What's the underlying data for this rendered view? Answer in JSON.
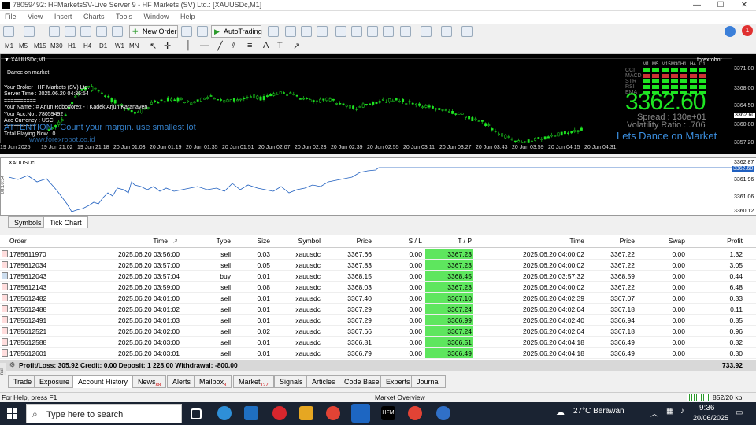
{
  "window": {
    "title": "78059492: HFMarketsSV-Live Server 9 - HF Markets (SV) Ltd.: [XAUUSDc,M1]"
  },
  "menu": [
    "File",
    "View",
    "Insert",
    "Charts",
    "Tools",
    "Window",
    "Help"
  ],
  "toolbar": {
    "new_order": "New Order",
    "autotrading": "AutoTrading"
  },
  "timeframes": [
    "M1",
    "M5",
    "M15",
    "M30",
    "H1",
    "H4",
    "D1",
    "W1",
    "MN"
  ],
  "chart": {
    "symbol": "XAUUSDc,M1",
    "brand": "forexrobot",
    "overlay_lines": [
      "Dance on market",
      "Your Broker : HF Markets (SV) Ltd.",
      "Server Time : 2025.06.20 04:36:54",
      "==========",
      "Your Name : # Arjun Robotforex - I Kadek Arjun Karanayen",
      "Your Acc.No : 78059492",
      "Acc Currency : USC",
      "==========",
      "Total Playing Now : 0"
    ],
    "warning": "ATTENTION - Count your margin. use smallest lot",
    "watermark": "www.forexrobot.co.id",
    "price_big": "3362.60",
    "spread": "Spread : 130e+01",
    "volatility": "Volatility Ratio : .706",
    "slogan": "Lets Dance on Market",
    "tf_panel": [
      "CCI",
      "MACD",
      "STR",
      "RSI",
      "EMA"
    ],
    "tf_headers": [
      "M1",
      "M5",
      "M15",
      "M30",
      "H1",
      "H4",
      "D1"
    ],
    "y_ticks": [
      "3371.80",
      "3368.00",
      "3364.50",
      "3362.60",
      "3360.80",
      "3357.20"
    ],
    "x_ticks": [
      "19 Jun 2025",
      "19 Jun 21:02",
      "19 Jun 21:18",
      "20 Jun 01:03",
      "20 Jun 01:19",
      "20 Jun 01:35",
      "20 Jun 01:51",
      "20 Jun 02:07",
      "20 Jun 02:23",
      "20 Jun 02:39",
      "20 Jun 02:55",
      "20 Jun 03:11",
      "20 Jun 03:27",
      "20 Jun 03:43",
      "20 Jun 03:59",
      "20 Jun 04:15",
      "20 Jun 04:31"
    ]
  },
  "tick": {
    "symbol": "XAUUSDc",
    "y_ticks": [
      "3362.87",
      "3362.60",
      "3361.96",
      "3361.06",
      "3360.12"
    ],
    "side_label": "08:10:54"
  },
  "panel_tabs": [
    "Symbols",
    "Tick Chart"
  ],
  "table": {
    "headers": [
      "Order",
      "Time",
      "Type",
      "Size",
      "Symbol",
      "Price",
      "S / L",
      "T / P",
      "Time",
      "Price",
      "Swap",
      "Profit"
    ],
    "rows": [
      [
        "1785611970",
        "2025.06.20 03:56:00",
        "sell",
        "0.03",
        "xauusdc",
        "3367.66",
        "0.00",
        "3367.23",
        "2025.06.20 04:00:02",
        "3367.22",
        "0.00",
        "1.32"
      ],
      [
        "1785612034",
        "2025.06.20 03:57:00",
        "sell",
        "0.05",
        "xauusdc",
        "3367.83",
        "0.00",
        "3367.23",
        "2025.06.20 04:00:02",
        "3367.22",
        "0.00",
        "3.05"
      ],
      [
        "1785612043",
        "2025.06.20 03:57:04",
        "buy",
        "0.01",
        "xauusdc",
        "3368.15",
        "0.00",
        "3368.45",
        "2025.06.20 03:57:32",
        "3368.59",
        "0.00",
        "0.44"
      ],
      [
        "1785612143",
        "2025.06.20 03:59:00",
        "sell",
        "0.08",
        "xauusdc",
        "3368.03",
        "0.00",
        "3367.23",
        "2025.06.20 04:00:02",
        "3367.22",
        "0.00",
        "6.48"
      ],
      [
        "1785612482",
        "2025.06.20 04:01:00",
        "sell",
        "0.01",
        "xauusdc",
        "3367.40",
        "0.00",
        "3367.10",
        "2025.06.20 04:02:39",
        "3367.07",
        "0.00",
        "0.33"
      ],
      [
        "1785612488",
        "2025.06.20 04:01:02",
        "sell",
        "0.01",
        "xauusdc",
        "3367.29",
        "0.00",
        "3367.24",
        "2025.06.20 04:02:04",
        "3367.18",
        "0.00",
        "0.11"
      ],
      [
        "1785612491",
        "2025.06.20 04:01:03",
        "sell",
        "0.01",
        "xauusdc",
        "3367.29",
        "0.00",
        "3366.99",
        "2025.06.20 04:02:40",
        "3366.94",
        "0.00",
        "0.35"
      ],
      [
        "1785612521",
        "2025.06.20 04:02:00",
        "sell",
        "0.02",
        "xauusdc",
        "3367.66",
        "0.00",
        "3367.24",
        "2025.06.20 04:02:04",
        "3367.18",
        "0.00",
        "0.96"
      ],
      [
        "1785612588",
        "2025.06.20 04:03:00",
        "sell",
        "0.01",
        "xauusdc",
        "3366.81",
        "0.00",
        "3366.51",
        "2025.06.20 04:04:18",
        "3366.49",
        "0.00",
        "0.32"
      ],
      [
        "1785612601",
        "2025.06.20 04:03:01",
        "sell",
        "0.01",
        "xauusdc",
        "3366.79",
        "0.00",
        "3366.49",
        "2025.06.20 04:04:18",
        "3366.49",
        "0.00",
        "0.30"
      ]
    ]
  },
  "summary": {
    "text": "Profit/Loss: 305.92  Credit: 0.00  Deposit: 1 228.00  Withdrawal: -800.00",
    "total": "733.92"
  },
  "terminal_tabs": [
    {
      "label": "Trade"
    },
    {
      "label": "Exposure"
    },
    {
      "label": "Account History"
    },
    {
      "label": "News",
      "badge": "88"
    },
    {
      "label": "Alerts"
    },
    {
      "label": "Mailbox",
      "badge": "8"
    },
    {
      "label": "Market",
      "badge": "127"
    },
    {
      "label": "Signals"
    },
    {
      "label": "Articles"
    },
    {
      "label": "Code Base"
    },
    {
      "label": "Experts"
    },
    {
      "label": "Journal"
    }
  ],
  "terminal_label": "Terminal",
  "status": {
    "help": "For Help, press F1",
    "market": "Market Overview",
    "traffic": "852/20 kb"
  },
  "taskbar": {
    "search": "Type here to search",
    "weather": "27°C  Berawan",
    "time": "9:36",
    "date": "20/06/2025"
  },
  "colors": {
    "profit_bg": "#5ee65e",
    "price_big": "#1ee622",
    "slogan": "#3b8fe0",
    "candle_up": "#1ee622"
  }
}
